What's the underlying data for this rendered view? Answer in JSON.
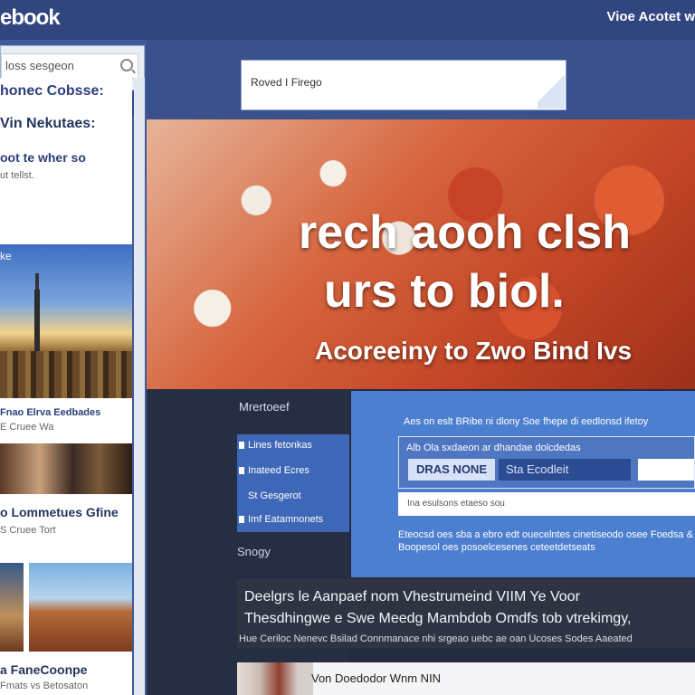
{
  "header": {
    "logo": "ebook",
    "right_text": "Vioe Acotet w"
  },
  "sidebar": {
    "search_placeholder": "loss sesgeon",
    "sections": [
      {
        "text": "honec Cobsse:"
      },
      {
        "text": "Vin Nekutaes:"
      },
      {
        "text": "oot te wher so"
      },
      {
        "text": "ut tellst."
      },
      {
        "text": "ke"
      },
      {
        "text": "Fnao Elrva Eedbades"
      },
      {
        "text": "E Cruee Wa"
      },
      {
        "text": "o Lommetues Gfine"
      },
      {
        "text": "S Cruee Tort"
      },
      {
        "text": "a FaneCoonpe"
      },
      {
        "text": "Fmats vs Betosaton"
      }
    ]
  },
  "top_input": {
    "value": "Roved I Firego"
  },
  "hero": {
    "line1": "rech aooh clsh",
    "line2": "urs to biol.",
    "sub": "Acoreeiny to Zwo Bind Ivs"
  },
  "left_panel": {
    "label": "Mrertoeef",
    "menu": [
      "Lines fetonkas",
      "Inateed Ecres",
      "St Gesgerot",
      "Imf Eatamnonets"
    ],
    "strategy": "Snogy"
  },
  "blue_panel": {
    "title": "Aes on eslt BRibe ni dlony Soe fhepe di eedlonsd ifetoy",
    "row_text": "Alb Ola sxdaeon ar dhandae dolcdedas",
    "drag_button": "DRAS NONE",
    "segment_text": "Sta Ecodleit",
    "input_text": "Ina esulsons etaeso sou",
    "desc": "Eteocsd oes sba a ebro edt ouecelntes cinetiseodo osee Foedsa & Boopesol oes posoelcesenes ceteetdetseats"
  },
  "news": {
    "title1": "Deelgrs le Aanpaef nom Vhestrumeind VIIM Ye Voor",
    "title2": "Thesdhingwe e Swe Meedg Mambdob Omdfs tob vtrekimgy,",
    "foot": "Hue Ceriloc Nenevc Bsilad Connmanace nhi srgeao uebc ae oan Ucoses Sodes Aaeated"
  },
  "bottom": {
    "label": "Von Doedodor Wnm NIN"
  },
  "colors": {
    "brand_blue": "#31467f",
    "panel_blue": "#4d7fd0",
    "dark_bg": "#262e44"
  }
}
